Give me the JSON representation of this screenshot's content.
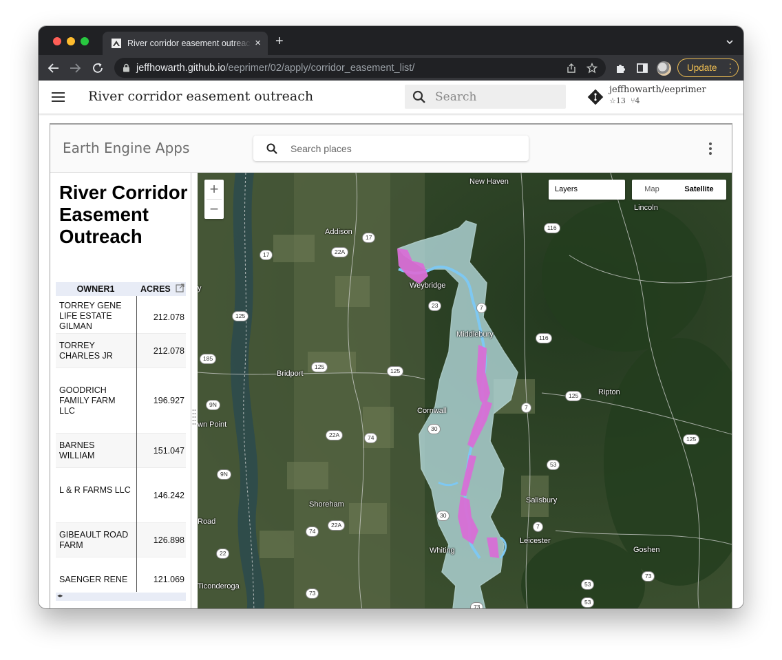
{
  "browser": {
    "tab_title": "River corridor easement outreach",
    "tab_close": "×",
    "new_tab": "+",
    "url_host": "jeffhowarth.github.io",
    "url_path": "/eeprimer/02/apply/corridor_easement_list/",
    "update_label": "Update"
  },
  "site": {
    "title": "River corridor easement outreach",
    "search_placeholder": "Search",
    "repo_name": "jeffhowarth/eeprimer",
    "repo_stars": "13",
    "repo_forks": "4"
  },
  "ee": {
    "title": "Earth Engine Apps",
    "search_placeholder": "Search places"
  },
  "panel": {
    "title": "River Corridor Easement Outreach",
    "columns": [
      "OWNER1",
      "ACRES"
    ],
    "rows": [
      {
        "owner": "TORREY GENE LIFE ESTATE GILMAN",
        "acres": "212.078"
      },
      {
        "owner": "TORREY CHARLES JR",
        "acres": "212.078"
      },
      {
        "owner": "GOODRICH FAMILY FARM LLC",
        "acres": "196.927"
      },
      {
        "owner": "BARNES WILLIAM",
        "acres": "151.047"
      },
      {
        "owner": "L & R FARMS LLC",
        "acres": "146.242"
      },
      {
        "owner": "GIBEAULT ROAD FARM",
        "acres": "126.898"
      },
      {
        "owner": "SAENGER RENE",
        "acres": "121.069"
      }
    ]
  },
  "map": {
    "zoom_in": "+",
    "zoom_out": "−",
    "layers_label": "Layers",
    "map_type_map": "Map",
    "map_type_satellite": "Satellite",
    "places": [
      "New Haven",
      "Lincoln",
      "Addison",
      "Weybridge",
      "Middlebury",
      "Bridport",
      "Cornwall",
      "Ripton",
      "Shoreham",
      "Salisbury",
      "Leicester",
      "Whiting",
      "Goshen",
      "Ticonderoga",
      "wn Point",
      "Road",
      "y"
    ],
    "route_shields": [
      "17",
      "17",
      "22A",
      "116",
      "125",
      "23",
      "7",
      "116",
      "185",
      "125",
      "125",
      "9N",
      "125",
      "7",
      "22A",
      "74",
      "30",
      "125",
      "53",
      "9N",
      "30",
      "22A",
      "74",
      "7",
      "22",
      "73",
      "73",
      "53",
      "73",
      "53",
      "73"
    ],
    "colors": {
      "corridor": "#b7dde0",
      "easement": "#d86fd6",
      "river": "#7ec8f2"
    }
  }
}
